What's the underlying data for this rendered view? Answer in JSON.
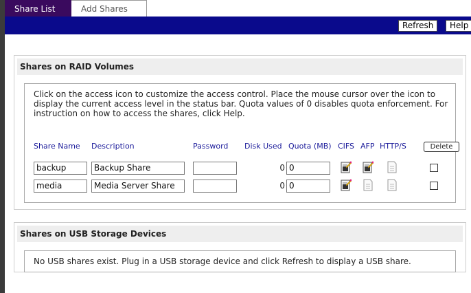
{
  "tabs": [
    {
      "label": "Share List",
      "active": true
    },
    {
      "label": "Add Shares",
      "active": false
    }
  ],
  "toolbar": {
    "refresh_label": "Refresh",
    "help_label": "Help"
  },
  "raid": {
    "title": "Shares on RAID Volumes",
    "intro": "Click on the access icon to customize the access control. Place the mouse cursor over the icon to display the current access level in the status bar. Quota values of 0 disables quota enforcement. For instruction on how to access the shares, click Help.",
    "columns": {
      "share_name": "Share Name",
      "description": "Description",
      "password": "Password",
      "disk_used": "Disk Used",
      "quota": "Quota (MB)",
      "cifs": "CIFS",
      "afp": "AFP",
      "https": "HTTP/S",
      "delete": "Delete"
    },
    "rows": [
      {
        "name": "backup",
        "description": "Backup Share",
        "password": "",
        "disk_used": "0",
        "quota": "0",
        "cifs": "edit-icon",
        "afp": "edit-icon",
        "https": "page-icon",
        "delete_checked": false
      },
      {
        "name": "media",
        "description": "Media Server Share",
        "password": "",
        "disk_used": "0",
        "quota": "0",
        "cifs": "edit-icon",
        "afp": "page-icon",
        "https": "page-icon",
        "delete_checked": false
      }
    ]
  },
  "usb": {
    "title": "Shares on USB Storage Devices",
    "message": "No USB shares exist. Plug in a USB storage device and click Refresh to display a USB share."
  },
  "colors": {
    "tab_active": "#3a0a5e",
    "toolbar": "#0a0a8c",
    "header_text": "#1a1a9a"
  }
}
